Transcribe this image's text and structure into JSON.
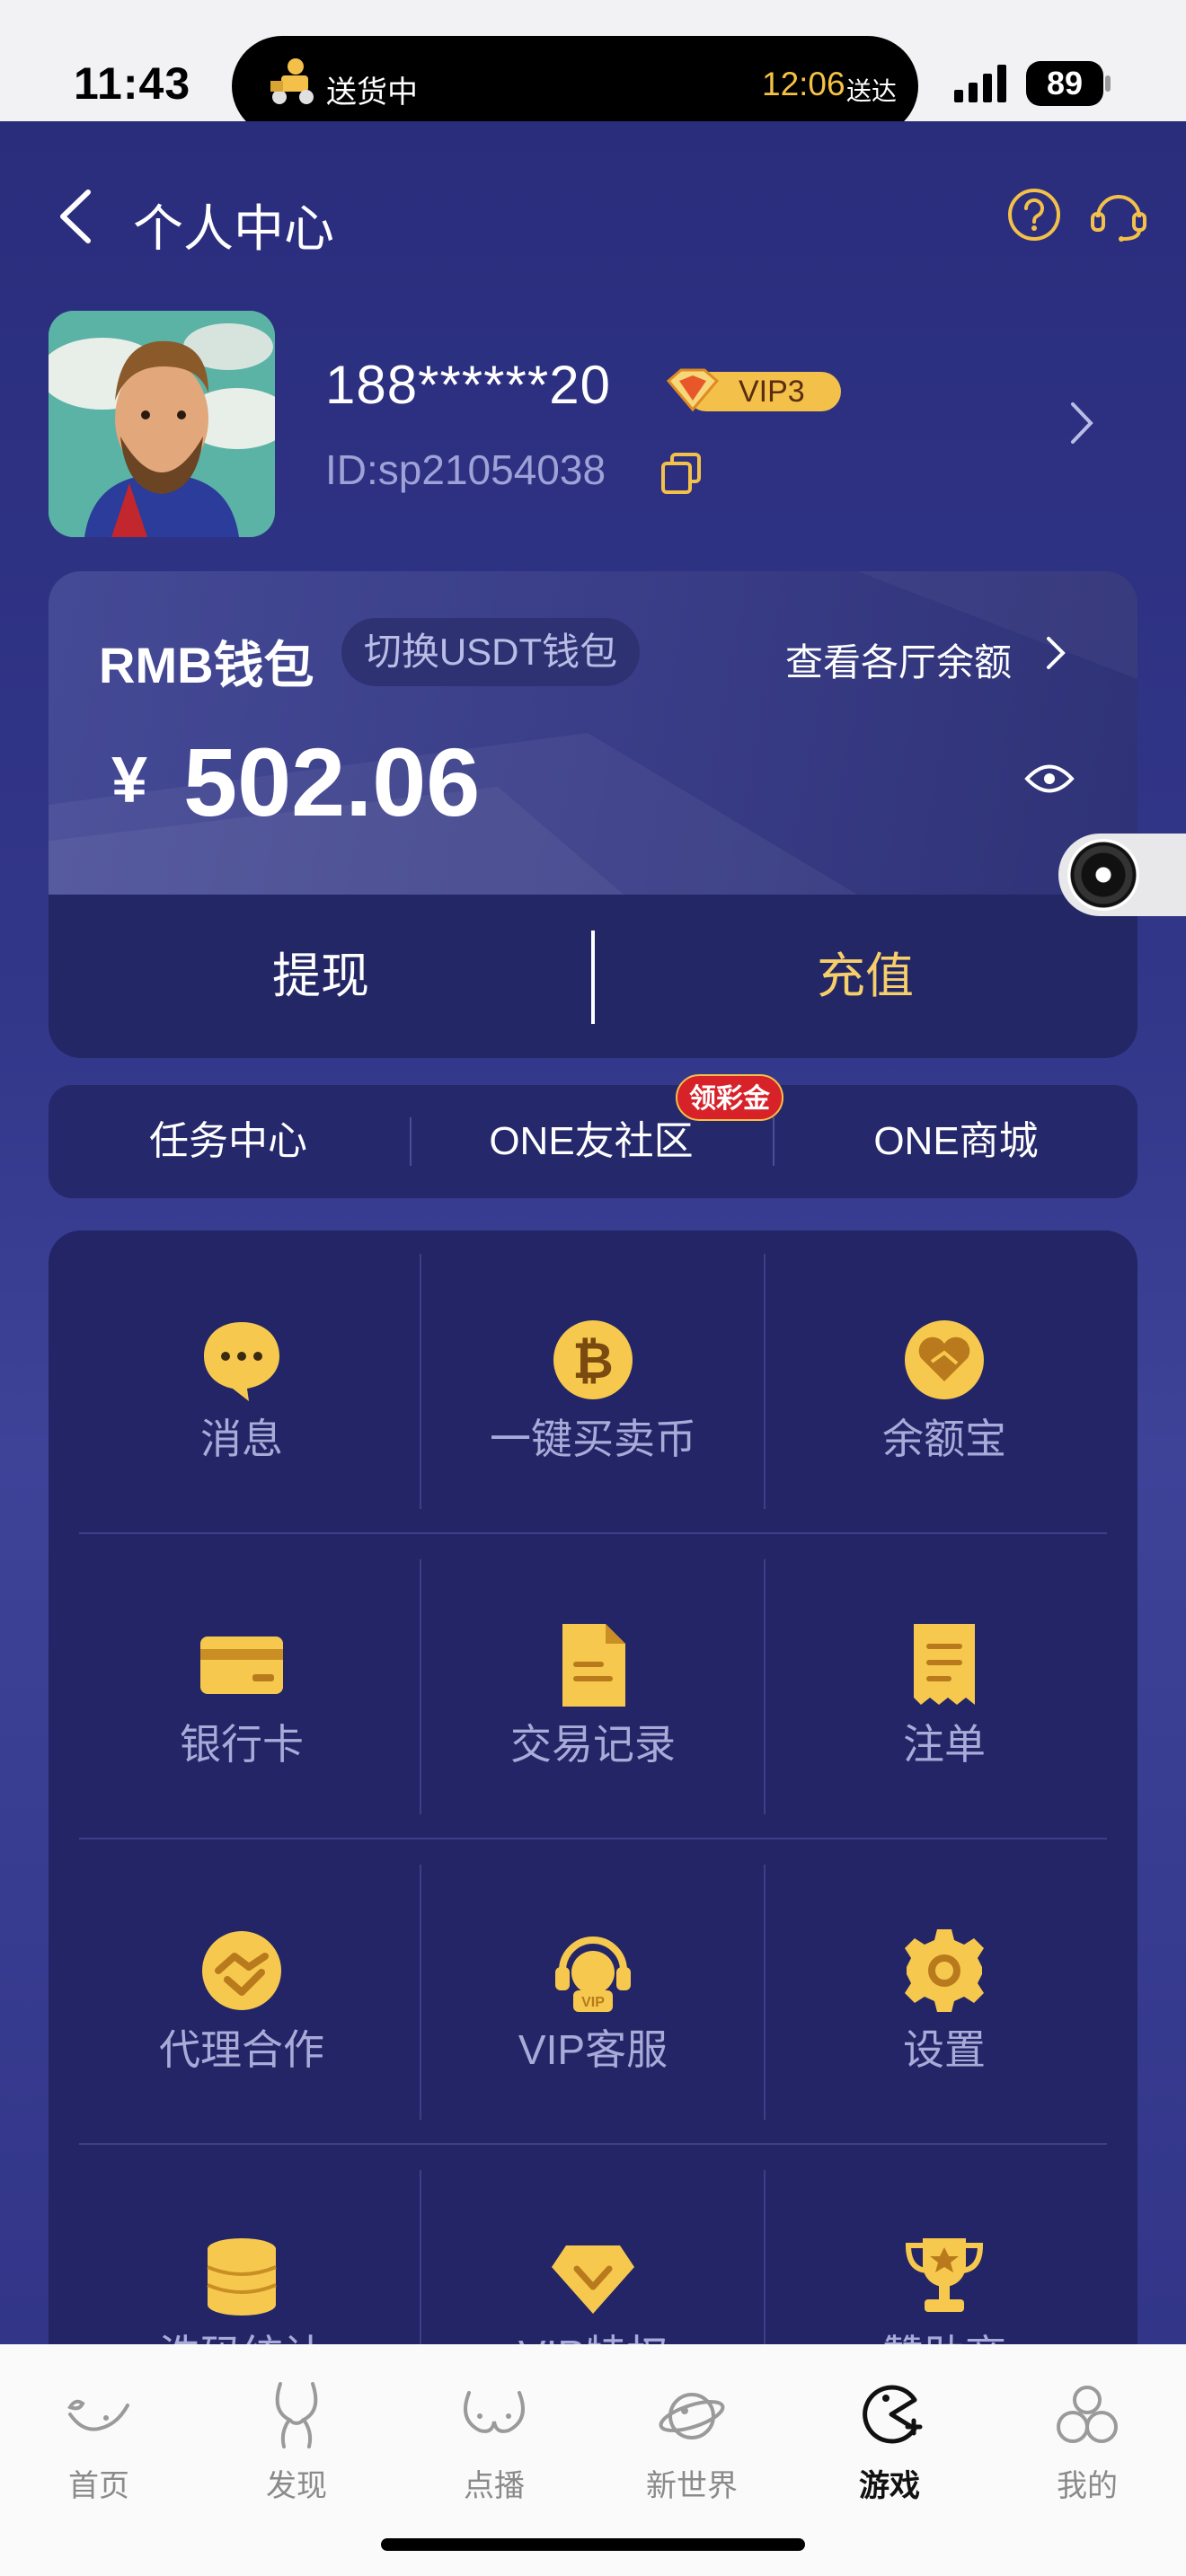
{
  "status_bar": {
    "time": "11:43",
    "activity_text": "送货中",
    "activity_time": "12:06",
    "activity_eta_label": "送达",
    "battery": "89"
  },
  "header": {
    "title": "个人中心"
  },
  "profile": {
    "username": "188******20",
    "vip_level": "VIP3",
    "id": "ID:sp21054038"
  },
  "wallet": {
    "name": "RMB钱包",
    "switch_label": "切换USDT钱包",
    "balances_link": "查看各厅余额",
    "currency": "¥",
    "amount": "502.06",
    "withdraw_label": "提现",
    "deposit_label": "充值",
    "accent": "#f6cf6a"
  },
  "tabs": [
    {
      "label": "任务中心"
    },
    {
      "label": "ONE友社区",
      "badge": "领彩金"
    },
    {
      "label": "ONE商城"
    }
  ],
  "grid": [
    {
      "label": "消息",
      "icon": "chat-bubble-icon"
    },
    {
      "label": "一键买卖币",
      "icon": "bitcoin-icon"
    },
    {
      "label": "余额宝",
      "icon": "handshake-heart-icon"
    },
    {
      "label": "银行卡",
      "icon": "bank-card-icon"
    },
    {
      "label": "交易记录",
      "icon": "document-icon"
    },
    {
      "label": "注单",
      "icon": "receipt-icon"
    },
    {
      "label": "代理合作",
      "icon": "handshake-icon"
    },
    {
      "label": "VIP客服",
      "icon": "vip-headset-icon"
    },
    {
      "label": "设置",
      "icon": "gear-icon"
    },
    {
      "label": "洗码统计",
      "icon": "coin-stack-icon"
    },
    {
      "label": "VIP特权",
      "icon": "diamond-icon"
    },
    {
      "label": "赞助商",
      "icon": "trophy-icon"
    }
  ],
  "bottom_nav": [
    {
      "label": "首页",
      "icon": "home-icon"
    },
    {
      "label": "发现",
      "icon": "discover-icon"
    },
    {
      "label": "点播",
      "icon": "video-icon"
    },
    {
      "label": "新世界",
      "icon": "planet-icon"
    },
    {
      "label": "游戏",
      "icon": "game-icon",
      "active": true
    },
    {
      "label": "我的",
      "icon": "profile-icon"
    }
  ]
}
